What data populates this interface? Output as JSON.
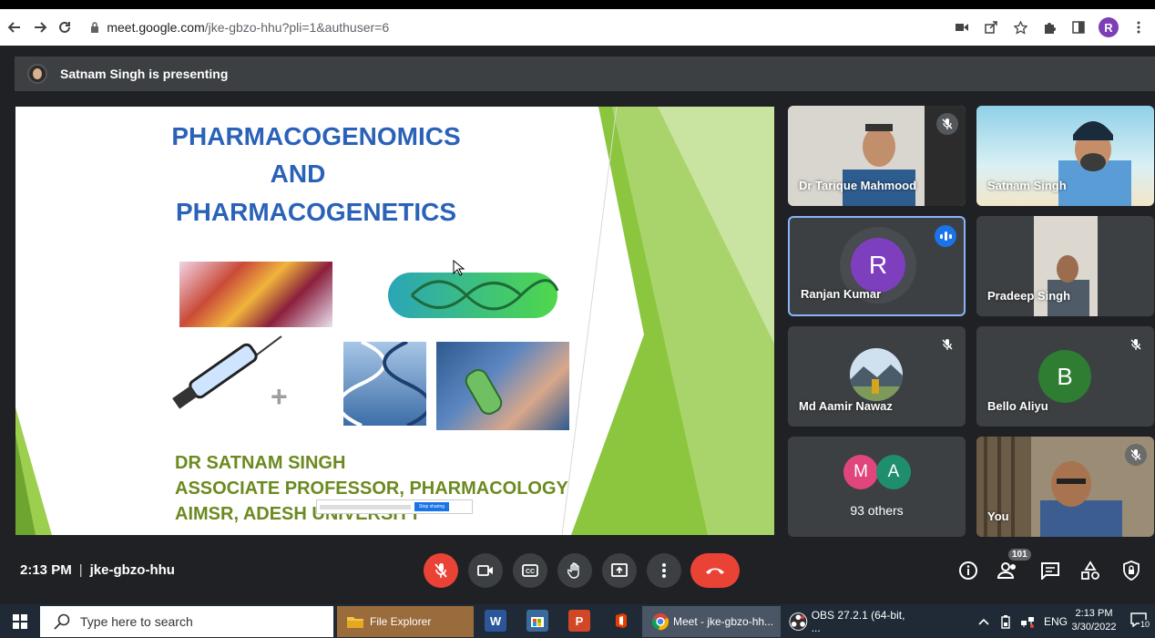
{
  "browser": {
    "url_host": "meet.google.com",
    "url_path": "/jke-gbzo-hhu?pli=1&authuser=6",
    "profile_initial": "R"
  },
  "presenting": {
    "text": "Satnam Singh is presenting"
  },
  "slide": {
    "title_line1": "PHARMACOGENOMICS",
    "title_line2": "AND",
    "title_line3": "PHARMACOGENETICS",
    "author_line1": "DR SATNAM SINGH",
    "author_line2": "ASSOCIATE  PROFESSOR,  PHARMACOLOGY",
    "author_line3": "AIMSR, ADESH UNIVERSITY",
    "stop_sharing_label": "Stop sharing",
    "colors": {
      "title": "#2a62b8",
      "author": "#6b8a1f",
      "green_band": "#8cc63f"
    }
  },
  "participants": [
    {
      "name": "Dr Tarique Mahmood",
      "muted": true,
      "type": "video"
    },
    {
      "name": "Satnam Singh",
      "muted": false,
      "type": "video"
    },
    {
      "name": "Ranjan Kumar",
      "muted": false,
      "type": "initial",
      "initial": "R",
      "color": "#7e3fbf",
      "speaking": true
    },
    {
      "name": "Pradeep Singh",
      "muted": false,
      "type": "video"
    },
    {
      "name": "Md Aamir Nawaz",
      "muted": true,
      "type": "photo"
    },
    {
      "name": "Bello Aliyu",
      "muted": true,
      "type": "initial",
      "initial": "B",
      "color": "#2e7d32"
    },
    {
      "name": "93 others",
      "type": "group",
      "initials": [
        "M",
        "A"
      ],
      "colors": [
        "#e0457b",
        "#1e8e6e"
      ]
    },
    {
      "name": "You",
      "muted": true,
      "type": "video"
    }
  ],
  "controls": {
    "time": "2:13 PM",
    "meeting_code": "jke-gbzo-hhu",
    "participant_count": "101"
  },
  "taskbar": {
    "search_placeholder": "Type here to search",
    "file_explorer_label": "File Explorer",
    "meet_label": "Meet - jke-gbzo-hh...",
    "obs_label": "OBS 27.2.1 (64-bit, ...",
    "language": "ENG",
    "clock_time": "2:13 PM",
    "clock_date": "3/30/2022",
    "notification_count": "10"
  }
}
